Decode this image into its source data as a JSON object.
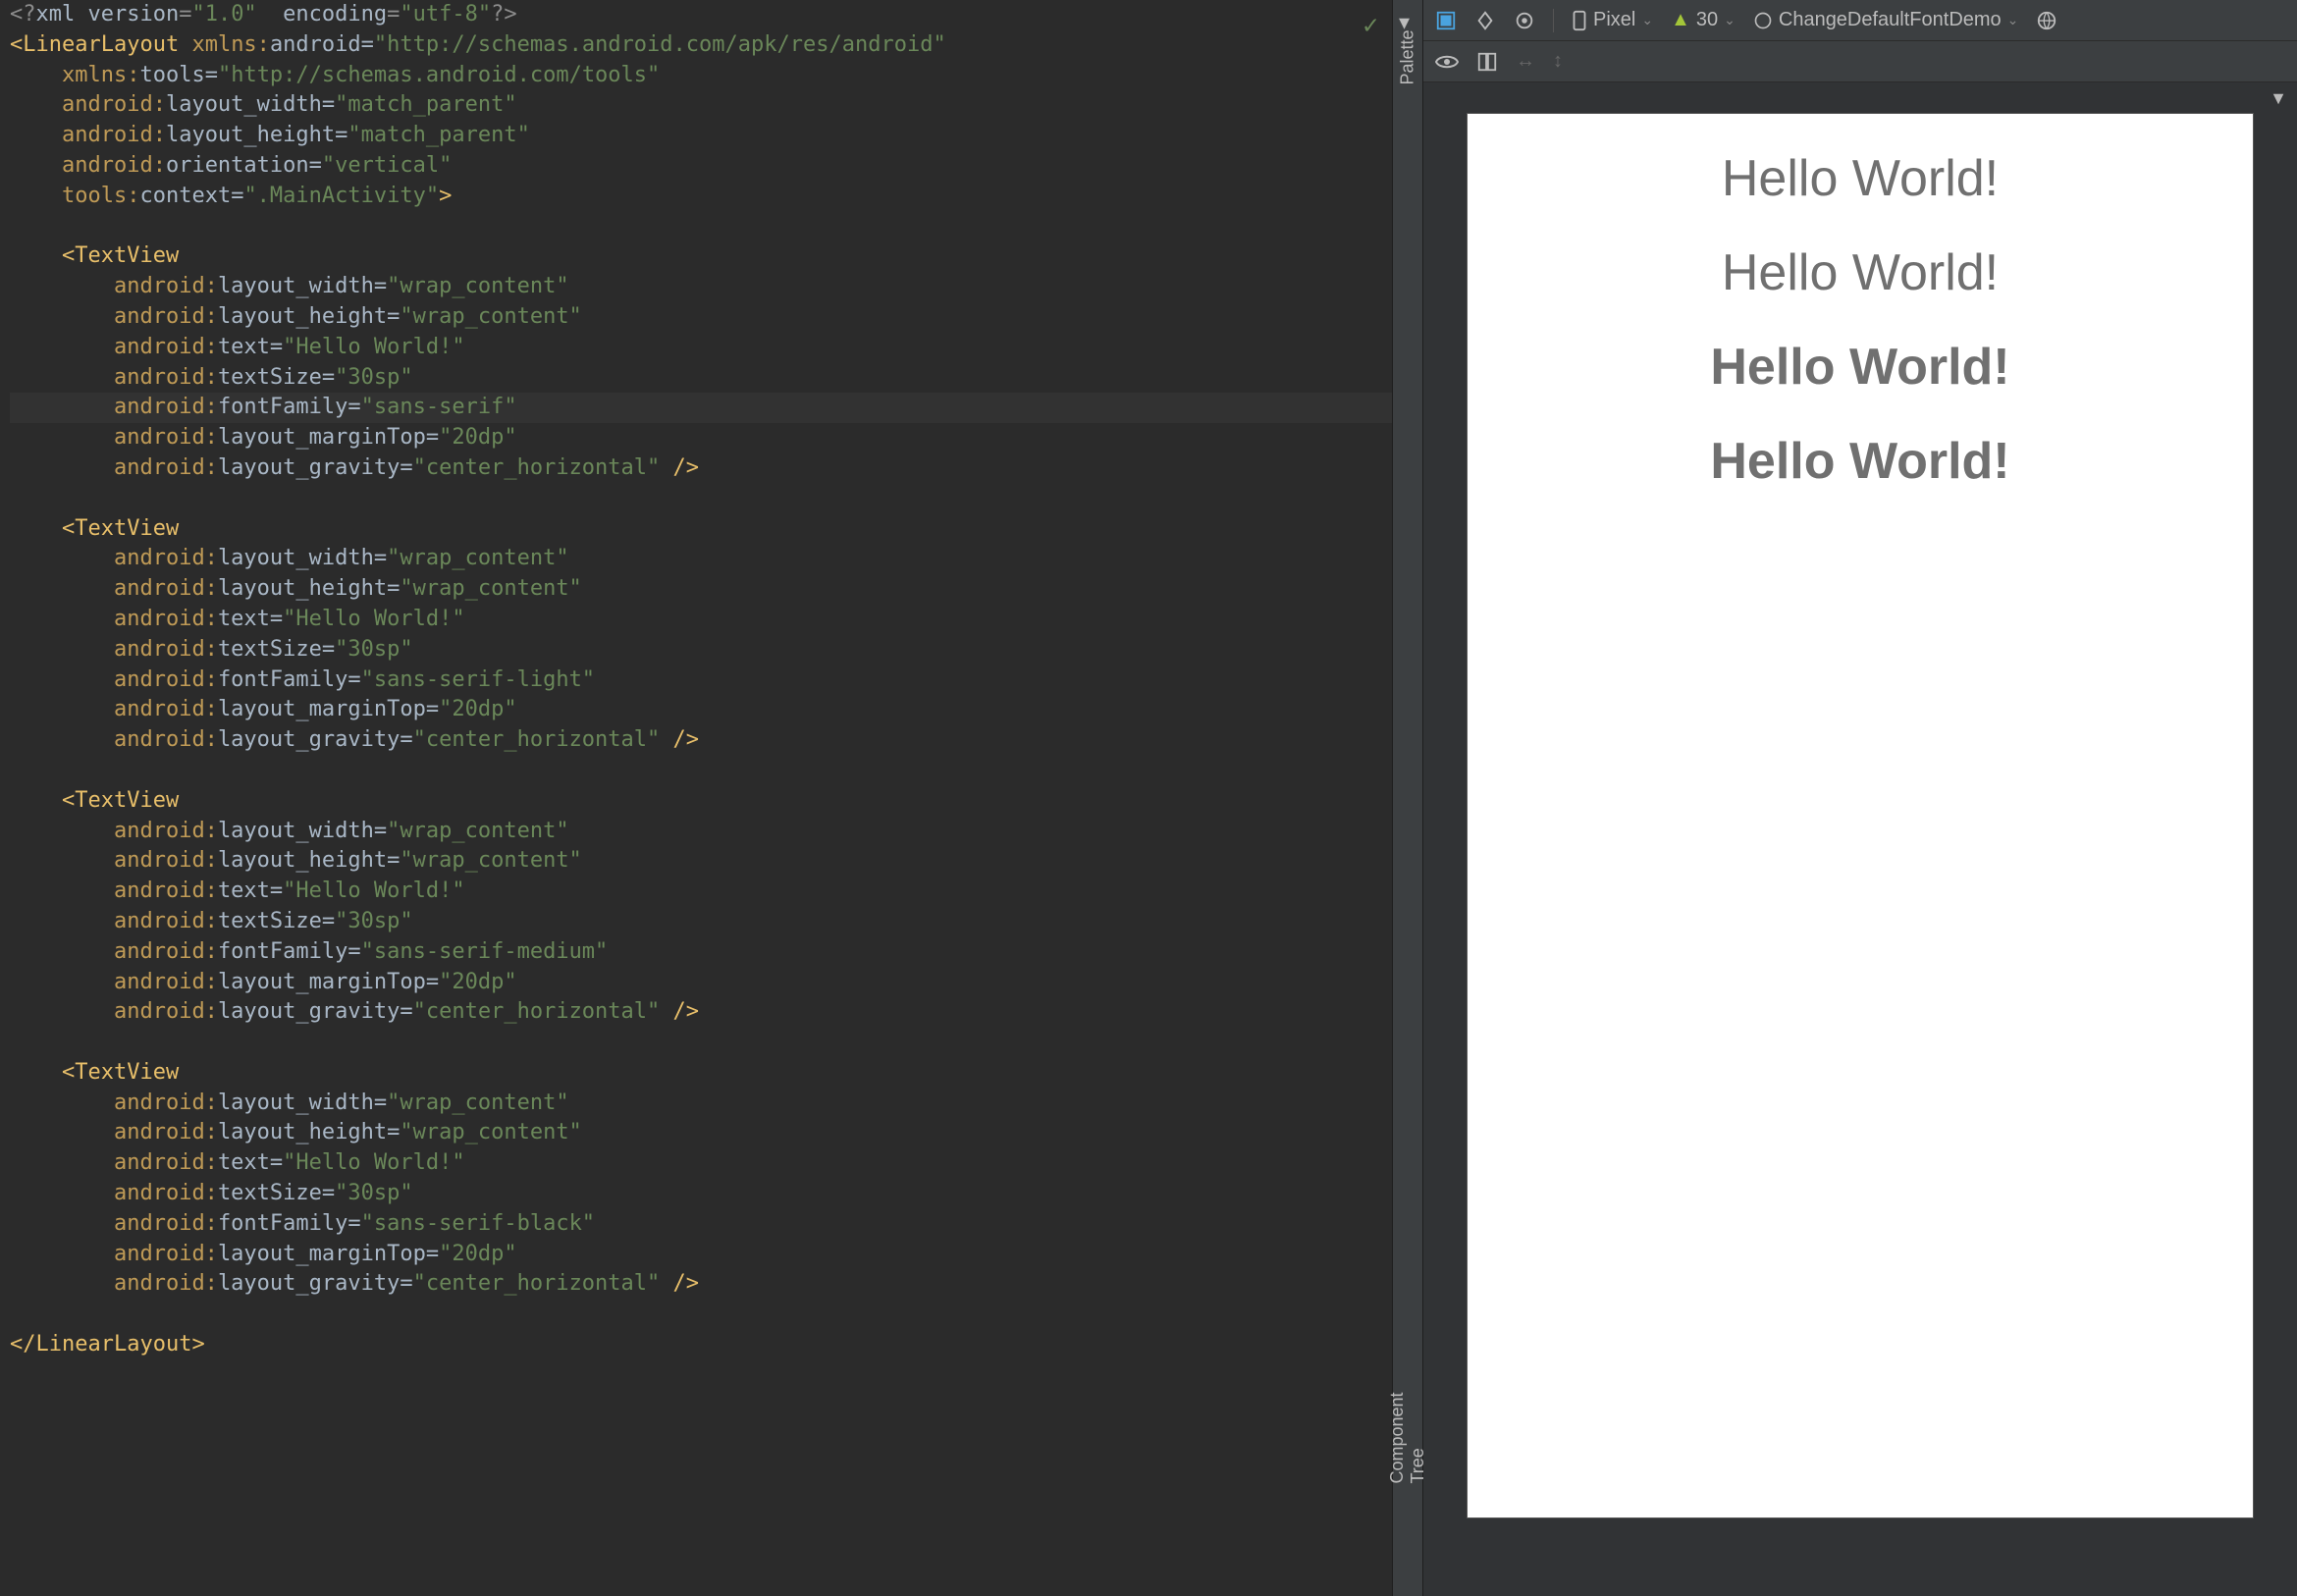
{
  "editor": {
    "lines": [
      {
        "t": "decl",
        "segs": [
          [
            "decl",
            "<?"
          ],
          [
            "attr",
            "xml version"
          ],
          [
            "decl",
            "="
          ],
          [
            "str",
            "\"1.0\""
          ],
          [
            "attr",
            "  encoding"
          ],
          [
            "decl",
            "="
          ],
          [
            "str",
            "\"utf-8\""
          ],
          [
            "decl",
            "?>"
          ]
        ]
      },
      {
        "t": "tag",
        "segs": [
          [
            "br",
            "<"
          ],
          [
            "tag",
            "LinearLayout"
          ],
          [
            "attr",
            " "
          ],
          [
            "ns",
            "xmlns:"
          ],
          [
            "attr",
            "android"
          ],
          [
            "attr",
            "="
          ],
          [
            "str",
            "\"http://schemas.android.com/apk/res/android\""
          ]
        ]
      },
      {
        "t": "attrline",
        "indent": "    ",
        "segs": [
          [
            "ns",
            "xmlns:"
          ],
          [
            "attr",
            "tools"
          ],
          [
            "attr",
            "="
          ],
          [
            "str",
            "\"http://schemas.android.com/tools\""
          ]
        ]
      },
      {
        "t": "attrline",
        "indent": "    ",
        "segs": [
          [
            "ns",
            "android:"
          ],
          [
            "attr",
            "layout_width"
          ],
          [
            "attr",
            "="
          ],
          [
            "str",
            "\"match_parent\""
          ]
        ]
      },
      {
        "t": "attrline",
        "indent": "    ",
        "segs": [
          [
            "ns",
            "android:"
          ],
          [
            "attr",
            "layout_height"
          ],
          [
            "attr",
            "="
          ],
          [
            "str",
            "\"match_parent\""
          ]
        ]
      },
      {
        "t": "attrline",
        "indent": "    ",
        "segs": [
          [
            "ns",
            "android:"
          ],
          [
            "attr",
            "orientation"
          ],
          [
            "attr",
            "="
          ],
          [
            "str",
            "\"vertical\""
          ]
        ]
      },
      {
        "t": "attrline",
        "indent": "    ",
        "segs": [
          [
            "ns",
            "tools:"
          ],
          [
            "attr",
            "context"
          ],
          [
            "attr",
            "="
          ],
          [
            "str",
            "\".MainActivity\""
          ],
          [
            "br",
            ">"
          ]
        ]
      },
      {
        "t": "blank"
      },
      {
        "t": "tag",
        "indent": "    ",
        "segs": [
          [
            "br",
            "<"
          ],
          [
            "tag",
            "TextView"
          ]
        ]
      },
      {
        "t": "attrline",
        "indent": "        ",
        "segs": [
          [
            "ns",
            "android:"
          ],
          [
            "attr",
            "layout_width"
          ],
          [
            "attr",
            "="
          ],
          [
            "str",
            "\"wrap_content\""
          ]
        ]
      },
      {
        "t": "attrline",
        "indent": "        ",
        "segs": [
          [
            "ns",
            "android:"
          ],
          [
            "attr",
            "layout_height"
          ],
          [
            "attr",
            "="
          ],
          [
            "str",
            "\"wrap_content\""
          ]
        ]
      },
      {
        "t": "attrline",
        "indent": "        ",
        "segs": [
          [
            "ns",
            "android:"
          ],
          [
            "attr",
            "text"
          ],
          [
            "attr",
            "="
          ],
          [
            "str",
            "\"Hello World!\""
          ]
        ]
      },
      {
        "t": "attrline",
        "indent": "        ",
        "segs": [
          [
            "ns",
            "android:"
          ],
          [
            "attr",
            "textSize"
          ],
          [
            "attr",
            "="
          ],
          [
            "str",
            "\"30sp\""
          ]
        ]
      },
      {
        "t": "attrline",
        "hl": true,
        "indent": "        ",
        "segs": [
          [
            "ns",
            "android:"
          ],
          [
            "attr",
            "fontFamily"
          ],
          [
            "attr",
            "="
          ],
          [
            "str",
            "\"sans-serif\""
          ]
        ]
      },
      {
        "t": "attrline",
        "indent": "        ",
        "segs": [
          [
            "ns",
            "android:"
          ],
          [
            "attr",
            "layout_marginTop"
          ],
          [
            "attr",
            "="
          ],
          [
            "str",
            "\"20dp\""
          ]
        ]
      },
      {
        "t": "attrline",
        "indent": "        ",
        "segs": [
          [
            "ns",
            "android:"
          ],
          [
            "attr",
            "layout_gravity"
          ],
          [
            "attr",
            "="
          ],
          [
            "str",
            "\"center_horizontal\""
          ],
          [
            "br",
            " />"
          ]
        ]
      },
      {
        "t": "blank"
      },
      {
        "t": "tag",
        "indent": "    ",
        "segs": [
          [
            "br",
            "<"
          ],
          [
            "tag",
            "TextView"
          ]
        ]
      },
      {
        "t": "attrline",
        "indent": "        ",
        "segs": [
          [
            "ns",
            "android:"
          ],
          [
            "attr",
            "layout_width"
          ],
          [
            "attr",
            "="
          ],
          [
            "str",
            "\"wrap_content\""
          ]
        ]
      },
      {
        "t": "attrline",
        "indent": "        ",
        "segs": [
          [
            "ns",
            "android:"
          ],
          [
            "attr",
            "layout_height"
          ],
          [
            "attr",
            "="
          ],
          [
            "str",
            "\"wrap_content\""
          ]
        ]
      },
      {
        "t": "attrline",
        "indent": "        ",
        "segs": [
          [
            "ns",
            "android:"
          ],
          [
            "attr",
            "text"
          ],
          [
            "attr",
            "="
          ],
          [
            "str",
            "\"Hello World!\""
          ]
        ]
      },
      {
        "t": "attrline",
        "indent": "        ",
        "segs": [
          [
            "ns",
            "android:"
          ],
          [
            "attr",
            "textSize"
          ],
          [
            "attr",
            "="
          ],
          [
            "str",
            "\"30sp\""
          ]
        ]
      },
      {
        "t": "attrline",
        "indent": "        ",
        "segs": [
          [
            "ns",
            "android:"
          ],
          [
            "attr",
            "fontFamily"
          ],
          [
            "attr",
            "="
          ],
          [
            "str",
            "\"sans-serif-light\""
          ]
        ]
      },
      {
        "t": "attrline",
        "indent": "        ",
        "segs": [
          [
            "ns",
            "android:"
          ],
          [
            "attr",
            "layout_marginTop"
          ],
          [
            "attr",
            "="
          ],
          [
            "str",
            "\"20dp\""
          ]
        ]
      },
      {
        "t": "attrline",
        "indent": "        ",
        "segs": [
          [
            "ns",
            "android:"
          ],
          [
            "attr",
            "layout_gravity"
          ],
          [
            "attr",
            "="
          ],
          [
            "str",
            "\"center_horizontal\""
          ],
          [
            "br",
            " />"
          ]
        ]
      },
      {
        "t": "blank"
      },
      {
        "t": "tag",
        "indent": "    ",
        "segs": [
          [
            "br",
            "<"
          ],
          [
            "tag",
            "TextView"
          ]
        ]
      },
      {
        "t": "attrline",
        "indent": "        ",
        "segs": [
          [
            "ns",
            "android:"
          ],
          [
            "attr",
            "layout_width"
          ],
          [
            "attr",
            "="
          ],
          [
            "str",
            "\"wrap_content\""
          ]
        ]
      },
      {
        "t": "attrline",
        "indent": "        ",
        "segs": [
          [
            "ns",
            "android:"
          ],
          [
            "attr",
            "layout_height"
          ],
          [
            "attr",
            "="
          ],
          [
            "str",
            "\"wrap_content\""
          ]
        ]
      },
      {
        "t": "attrline",
        "indent": "        ",
        "segs": [
          [
            "ns",
            "android:"
          ],
          [
            "attr",
            "text"
          ],
          [
            "attr",
            "="
          ],
          [
            "str",
            "\"Hello World!\""
          ]
        ]
      },
      {
        "t": "attrline",
        "indent": "        ",
        "segs": [
          [
            "ns",
            "android:"
          ],
          [
            "attr",
            "textSize"
          ],
          [
            "attr",
            "="
          ],
          [
            "str",
            "\"30sp\""
          ]
        ]
      },
      {
        "t": "attrline",
        "indent": "        ",
        "segs": [
          [
            "ns",
            "android:"
          ],
          [
            "attr",
            "fontFamily"
          ],
          [
            "attr",
            "="
          ],
          [
            "str",
            "\"sans-serif-medium\""
          ]
        ]
      },
      {
        "t": "attrline",
        "indent": "        ",
        "segs": [
          [
            "ns",
            "android:"
          ],
          [
            "attr",
            "layout_marginTop"
          ],
          [
            "attr",
            "="
          ],
          [
            "str",
            "\"20dp\""
          ]
        ]
      },
      {
        "t": "attrline",
        "indent": "        ",
        "segs": [
          [
            "ns",
            "android:"
          ],
          [
            "attr",
            "layout_gravity"
          ],
          [
            "attr",
            "="
          ],
          [
            "str",
            "\"center_horizontal\""
          ],
          [
            "br",
            " />"
          ]
        ]
      },
      {
        "t": "blank"
      },
      {
        "t": "tag",
        "indent": "    ",
        "segs": [
          [
            "br",
            "<"
          ],
          [
            "tag",
            "TextView"
          ]
        ]
      },
      {
        "t": "attrline",
        "indent": "        ",
        "segs": [
          [
            "ns",
            "android:"
          ],
          [
            "attr",
            "layout_width"
          ],
          [
            "attr",
            "="
          ],
          [
            "str",
            "\"wrap_content\""
          ]
        ]
      },
      {
        "t": "attrline",
        "indent": "        ",
        "segs": [
          [
            "ns",
            "android:"
          ],
          [
            "attr",
            "layout_height"
          ],
          [
            "attr",
            "="
          ],
          [
            "str",
            "\"wrap_content\""
          ]
        ]
      },
      {
        "t": "attrline",
        "indent": "        ",
        "segs": [
          [
            "ns",
            "android:"
          ],
          [
            "attr",
            "text"
          ],
          [
            "attr",
            "="
          ],
          [
            "str",
            "\"Hello World!\""
          ]
        ]
      },
      {
        "t": "attrline",
        "indent": "        ",
        "segs": [
          [
            "ns",
            "android:"
          ],
          [
            "attr",
            "textSize"
          ],
          [
            "attr",
            "="
          ],
          [
            "str",
            "\"30sp\""
          ]
        ]
      },
      {
        "t": "attrline",
        "indent": "        ",
        "segs": [
          [
            "ns",
            "android:"
          ],
          [
            "attr",
            "fontFamily"
          ],
          [
            "attr",
            "="
          ],
          [
            "str",
            "\"sans-serif-black\""
          ]
        ]
      },
      {
        "t": "attrline",
        "indent": "        ",
        "segs": [
          [
            "ns",
            "android:"
          ],
          [
            "attr",
            "layout_marginTop"
          ],
          [
            "attr",
            "="
          ],
          [
            "str",
            "\"20dp\""
          ]
        ]
      },
      {
        "t": "attrline",
        "indent": "        ",
        "segs": [
          [
            "ns",
            "android:"
          ],
          [
            "attr",
            "layout_gravity"
          ],
          [
            "attr",
            "="
          ],
          [
            "str",
            "\"center_horizontal\""
          ],
          [
            "br",
            " />"
          ]
        ]
      },
      {
        "t": "blank"
      },
      {
        "t": "tag",
        "segs": [
          [
            "br",
            "</"
          ],
          [
            "tag",
            "LinearLayout"
          ],
          [
            "br",
            ">"
          ]
        ]
      }
    ]
  },
  "palette": {
    "label": "Palette",
    "tree_label": "Component Tree"
  },
  "toolbar": {
    "device": "Pixel",
    "api": "30",
    "theme": "ChangeDefaultFontDemo"
  },
  "preview": {
    "texts": [
      "Hello World!",
      "Hello World!",
      "Hello World!",
      "Hello World!"
    ]
  }
}
